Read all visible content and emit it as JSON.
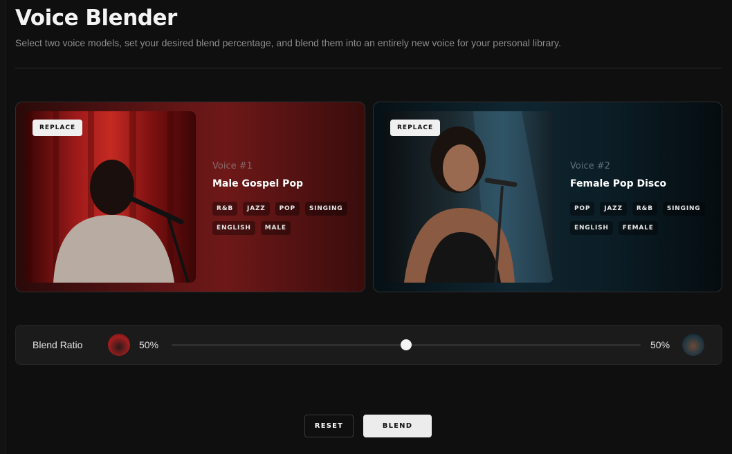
{
  "header": {
    "title": "Voice Blender",
    "subtitle": "Select two voice models, set your desired blend percentage, and blend them into an entirely new voice for your personal library."
  },
  "voices": [
    {
      "replace_label": "REPLACE",
      "slot_label": "Voice #1",
      "name": "Male Gospel Pop",
      "tags": [
        "R&B",
        "JAZZ",
        "POP",
        "SINGING",
        "ENGLISH",
        "MALE"
      ],
      "accent": "#6e1818"
    },
    {
      "replace_label": "REPLACE",
      "slot_label": "Voice #2",
      "name": "Female Pop Disco",
      "tags": [
        "POP",
        "JAZZ",
        "R&B",
        "SINGING",
        "ENGLISH",
        "FEMALE"
      ],
      "accent": "#0f2631"
    }
  ],
  "blend": {
    "label": "Blend Ratio",
    "left_percent": "50%",
    "right_percent": "50%",
    "ratio": 0.5
  },
  "actions": {
    "reset_label": "RESET",
    "blend_label": "BLEND"
  }
}
